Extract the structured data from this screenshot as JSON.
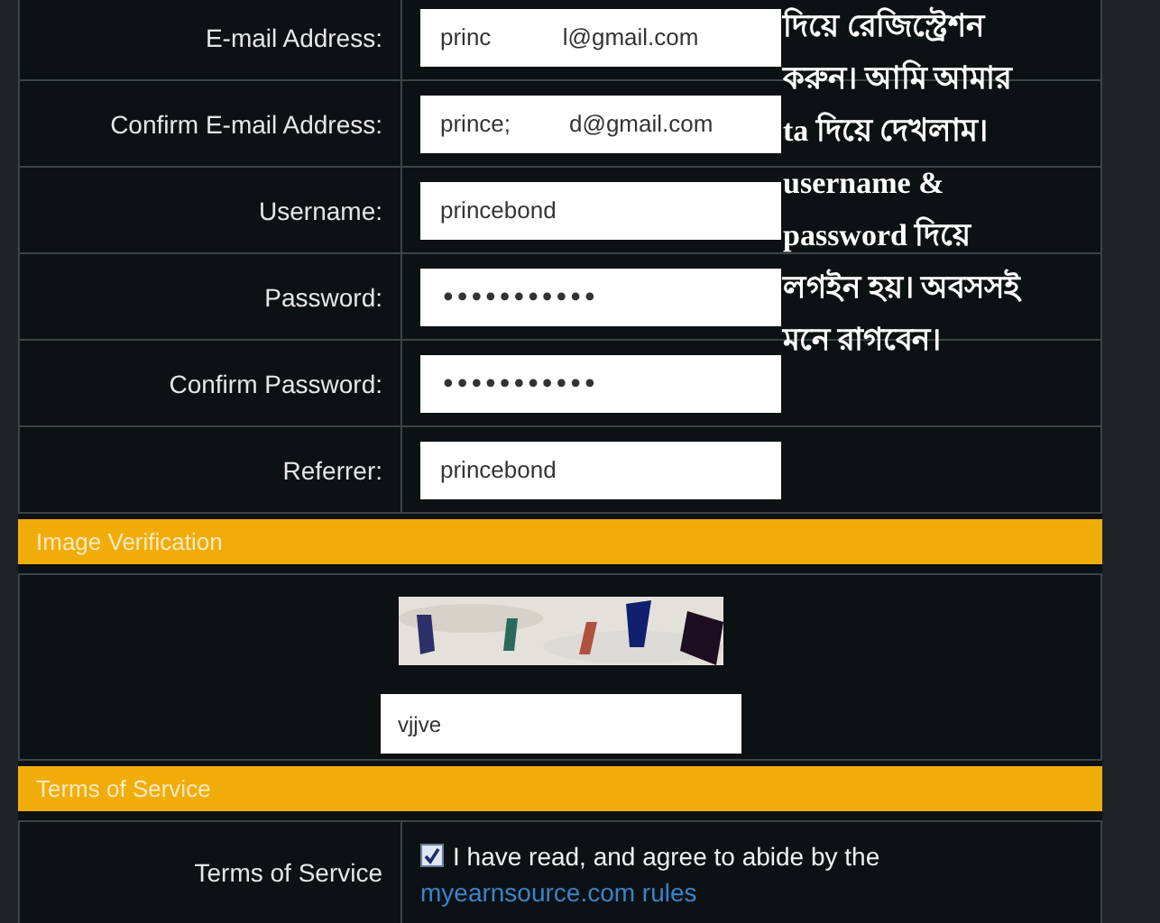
{
  "form_rows": [
    {
      "label": "E-mail Address:",
      "kind": "text",
      "value": "princ           l@gmail.com"
    },
    {
      "label": "Confirm E-mail Address:",
      "kind": "text",
      "value": "prince;         d@gmail.com"
    },
    {
      "label": "Username:",
      "kind": "text",
      "value": "princebond"
    },
    {
      "label": "Password:",
      "kind": "password",
      "value": "•••••••••••"
    },
    {
      "label": "Confirm Password:",
      "kind": "password",
      "value": "•••••••••••"
    },
    {
      "label": "Referrer:",
      "kind": "text",
      "value": "princebond"
    }
  ],
  "image_verification": {
    "heading": "Image Verification",
    "answer": "vjjve"
  },
  "terms": {
    "heading": "Terms of Service",
    "label": "Terms of Service",
    "checked": true,
    "text": "I have read, and agree to abide by the",
    "link": "myearnsource.com rules"
  },
  "note_lines": [
    "দিয়ে রেজিস্ট্রেশন",
    "করুন। আমি আমার",
    "ta দিয়ে দেখলাম।",
    "username &",
    "password  দিয়ে",
    "লগইন হয়। অবসসই",
    "মনে রাগবেন।"
  ]
}
